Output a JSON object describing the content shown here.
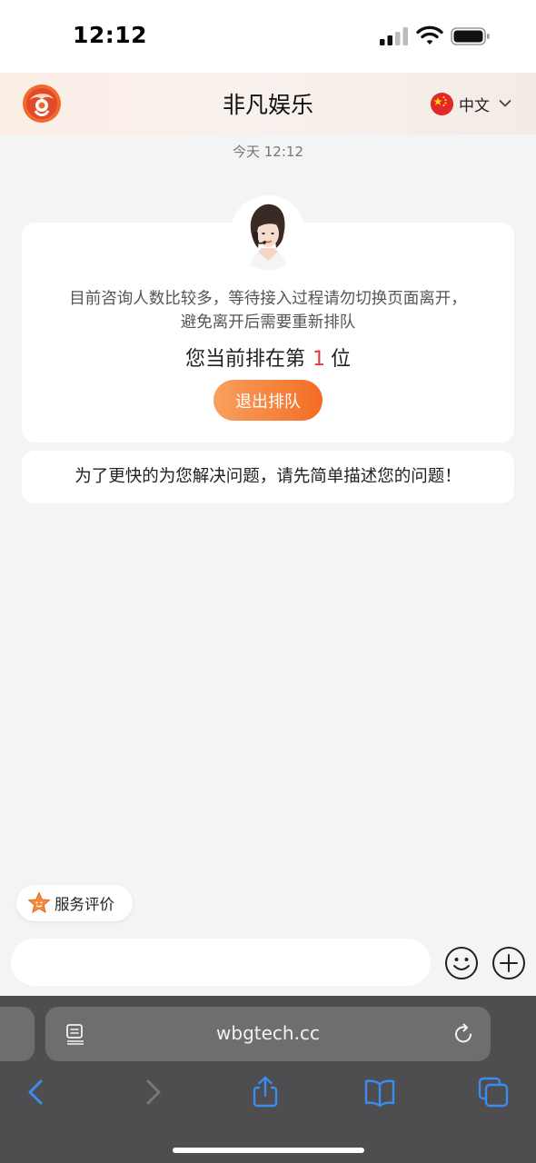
{
  "status_bar": {
    "time": "12:12"
  },
  "header": {
    "title": "非凡娱乐",
    "language": "中文"
  },
  "chat": {
    "timestamp": "今天 12:12",
    "queue_message_line1": "目前咨询人数比较多，等待接入过程请勿切换页面离开，",
    "queue_message_line2": "避免离开后需要重新排队",
    "position_prefix": "您当前排在第",
    "position_number": "1",
    "position_suffix": "位",
    "exit_queue_label": "退出排队",
    "hint_message": "为了更快的为您解决问题，请先简单描述您的问题！"
  },
  "rating": {
    "label": "服务评价"
  },
  "composer": {
    "placeholder": ""
  },
  "browser": {
    "url": "wbgtech.cc"
  },
  "colors": {
    "accent_orange": "#f36d22",
    "highlight_red": "#e4393c",
    "ios_blue": "#3b8cf0"
  },
  "icons": [
    "signal-icon",
    "wifi-icon",
    "battery-icon",
    "logo-icon",
    "china-flag-icon",
    "chevron-down-icon",
    "star-icon",
    "emoji-icon",
    "plus-icon",
    "page-menu-icon",
    "reload-icon",
    "back-icon",
    "forward-icon",
    "share-icon",
    "bookmarks-icon",
    "tabs-icon"
  ]
}
